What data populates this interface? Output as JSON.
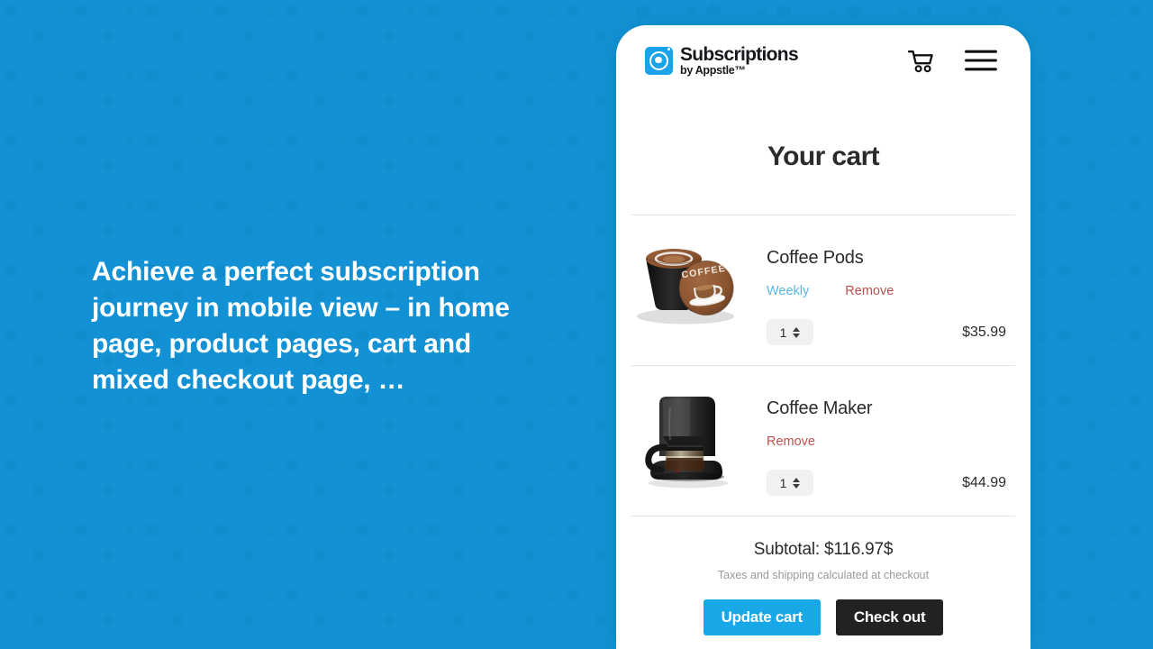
{
  "theme": {
    "backdrop_color": "#1292d4",
    "accent_blue": "#18a8e8",
    "plan_link_color": "#5cb6e6",
    "remove_link_color": "#bf514f",
    "checkout_button_color": "#222222",
    "text_color": "#2b2b2b"
  },
  "marketing": {
    "headline": "Achieve a perfect subscription journey in mobile view – in home page, product pages, cart and mixed checkout page, …"
  },
  "store": {
    "logo": {
      "icon": "appstle-subscriptions-logo-icon",
      "title": "Subscriptions",
      "subtitle": "by Appstle™"
    },
    "actions": [
      {
        "name": "cart-icon",
        "label": "Cart"
      },
      {
        "name": "menu-icon",
        "label": "Menu"
      }
    ]
  },
  "cart": {
    "title": "Your cart",
    "items": [
      {
        "name": "Coffee Pods",
        "image": "coffee-pods-image",
        "plan_label": "Weekly",
        "remove_label": "Remove",
        "quantity": "1",
        "price": "$35.99"
      },
      {
        "name": "Coffee Maker",
        "image": "coffee-maker-image",
        "plan_label": "",
        "remove_label": "Remove",
        "quantity": "1",
        "price": "$44.99"
      }
    ],
    "subtotal_label": "Subtotal: $116.97$",
    "tax_note": "Taxes and shipping calculated at checkout",
    "update_label": "Update cart",
    "checkout_label": "Check out"
  }
}
